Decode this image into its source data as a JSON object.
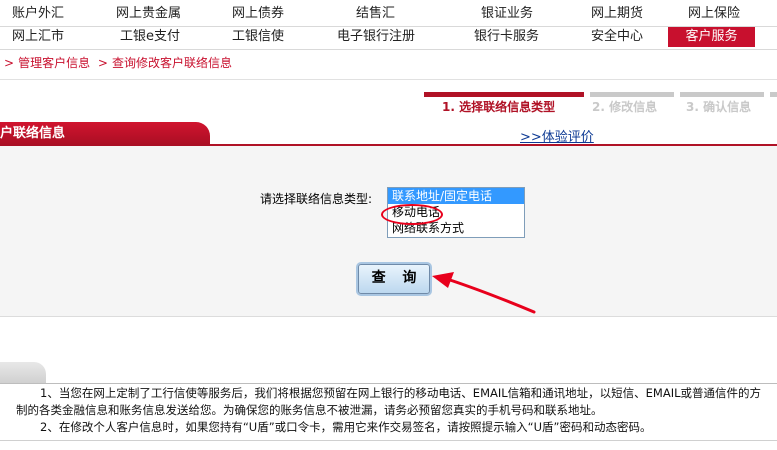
{
  "nav": {
    "row1": [
      "账户外汇",
      "网上贵金属",
      "网上债券",
      "结售汇",
      "银证业务",
      "网上期货",
      "网上保险"
    ],
    "row2": [
      "网上汇市",
      "工银e支付",
      "工银信使",
      "电子银行注册",
      "银行卡服务",
      "安全中心",
      "客户服务"
    ],
    "active": "客户服务"
  },
  "breadcrumb": [
    "管理客户信息",
    "查询修改客户联络信息"
  ],
  "steps": [
    "1. 选择联络信息类型",
    "2. 修改信息",
    "3. 确认信息"
  ],
  "section": {
    "title": "户联络信息",
    "feedback_link": ">>体验评价"
  },
  "form": {
    "label": "请选择联络信息类型:",
    "options": [
      "联系地址/固定电话",
      "移动电话",
      "网络联系方式"
    ],
    "selected_index": 0,
    "query_button": "查 询"
  },
  "notes": [
    "1、当您在网上定制了工行信使等服务后，我们将根据您预留在网上银行的移动电话、EMAIL信箱和通讯地址，以短信、EMAIL或普通信件的方",
    "制的各类金融信息和账务信息发送给您。为确保您的账务信息不被泄漏，请务必预留您真实的手机号码和联系地址。",
    "2、在修改个人客户信息时，如果您持有“U盾”或口令卡，需用它来作交易签名，请按照提示输入“U盾”密码和动态密码。"
  ],
  "colors": {
    "brand_red": "#c8102e",
    "selection_blue": "#3399ff",
    "link_blue": "#0d3a94"
  }
}
